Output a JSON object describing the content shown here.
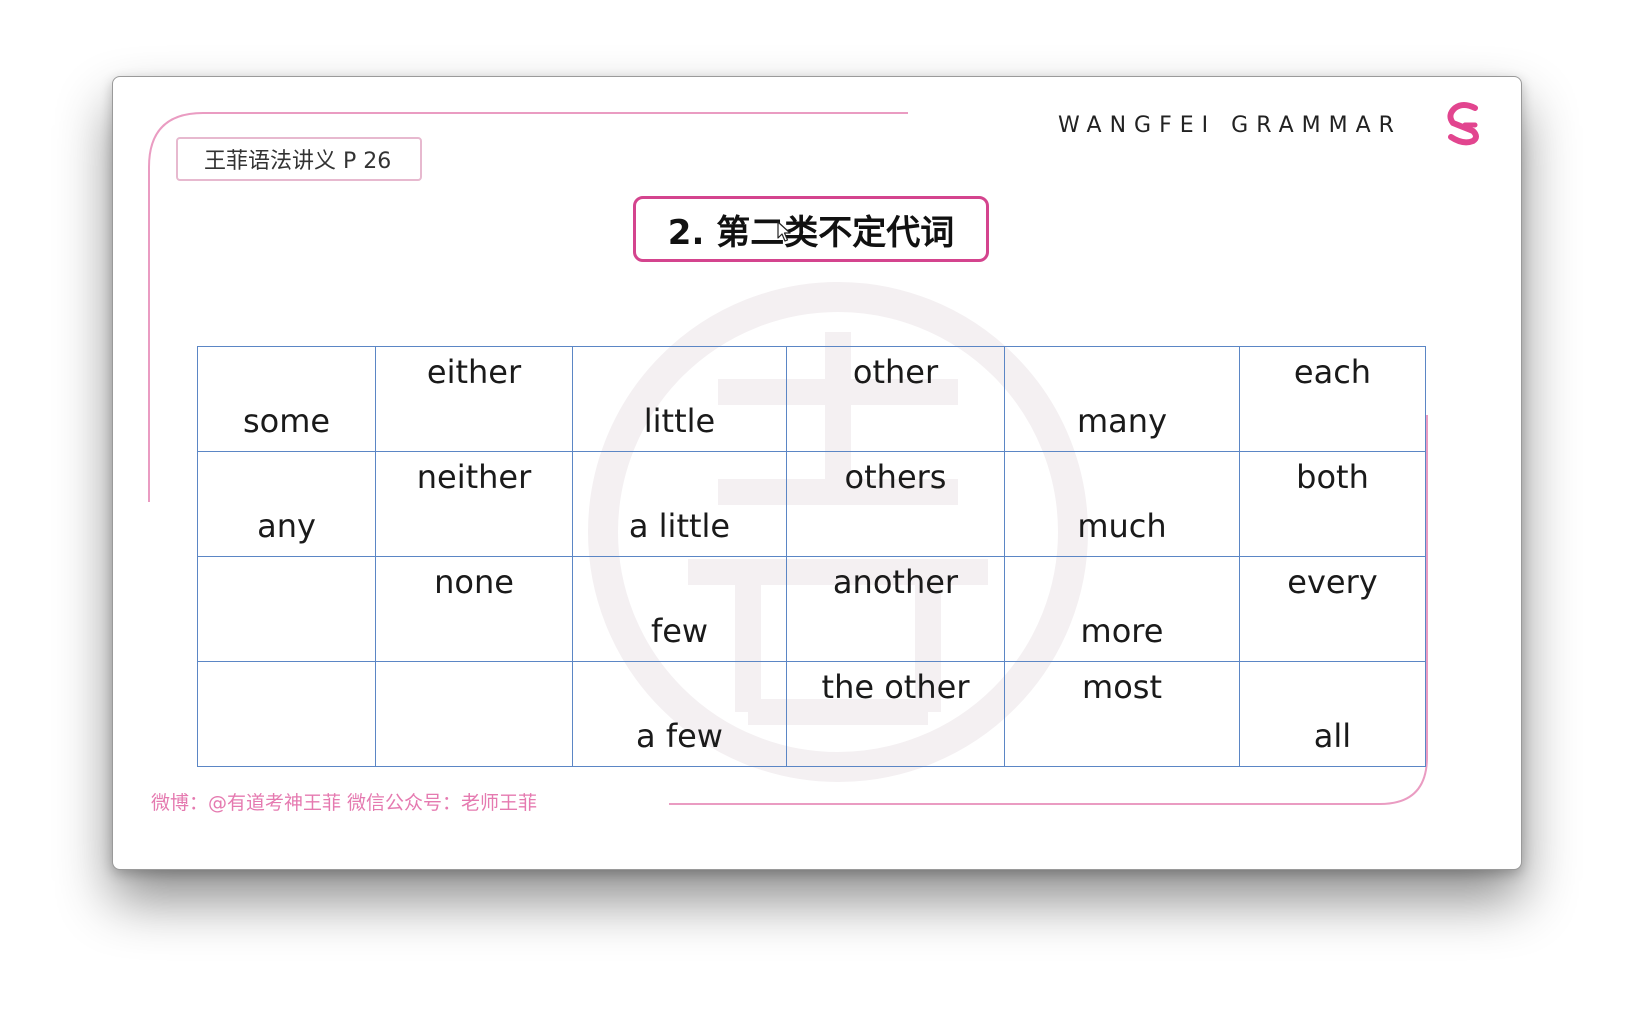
{
  "slide": {
    "page_reference": "王菲语法讲义  P 26",
    "brand_name": "WANGFEI GRAMMAR",
    "brand_logo_icon": "pink-g-logo-icon",
    "section_title": "2. 第二类不定代词",
    "footer": "微博：@有道考神王菲 微信公众号：老师王菲",
    "colors": {
      "accent_pink": "#d4448e",
      "light_pink": "#e7b9cf",
      "grid_blue": "#5b86c5"
    }
  },
  "table": {
    "rows": [
      [
        "some",
        "either",
        "little",
        "other",
        "many",
        "each"
      ],
      [
        "any",
        "neither",
        "a little",
        "others",
        "much",
        "both"
      ],
      [
        "",
        "none",
        "few",
        "another",
        "more",
        "every"
      ],
      [
        "",
        "",
        "a few",
        "the other",
        "most",
        "all"
      ]
    ]
  }
}
